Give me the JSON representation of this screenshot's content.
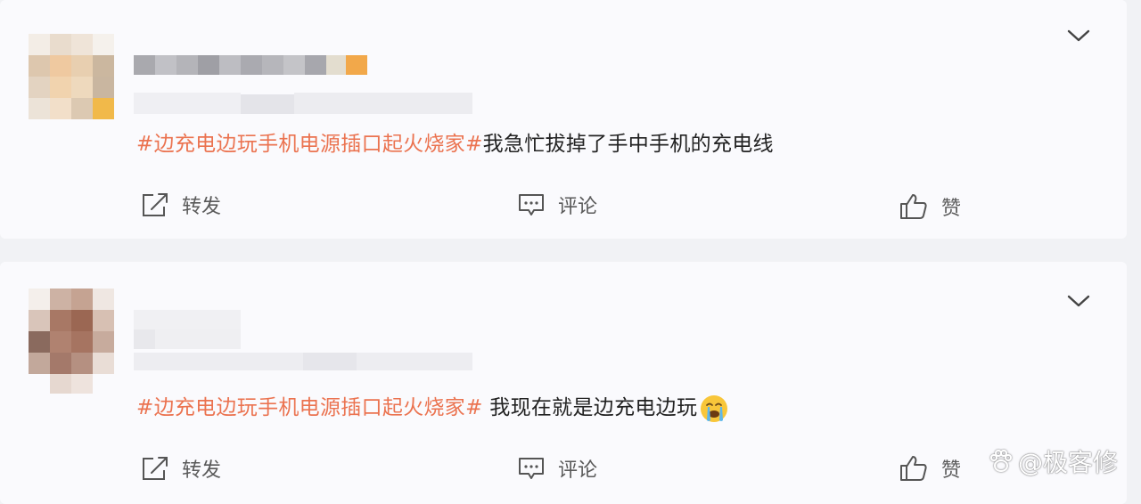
{
  "posts": [
    {
      "hashtag": "#边充电边玩手机电源插口起火烧家#",
      "body": "我急忙拔掉了手中手机的充电线",
      "actions": {
        "repost": "转发",
        "comment": "评论",
        "like": "赞"
      }
    },
    {
      "hashtag": "#边充电边玩手机电源插口起火烧家#",
      "body": " 我现在就是边充电边玩",
      "emoji": "crying-face-emoji",
      "actions": {
        "repost": "转发",
        "comment": "评论",
        "like": "赞"
      }
    }
  ],
  "watermark": {
    "text": "@极客修",
    "icon": "paw-icon"
  },
  "colors": {
    "hashtag": "#eb7350",
    "text": "#222222",
    "action": "#5a5a5a",
    "card": "#fafafd",
    "page": "#f1f2f5"
  }
}
